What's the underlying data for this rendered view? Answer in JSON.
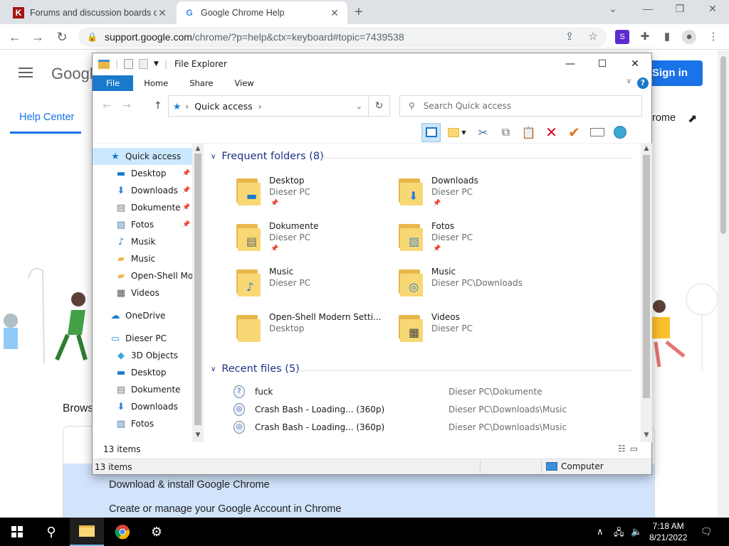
{
  "browser": {
    "tabs": [
      {
        "title": "Forums and discussion boards or",
        "favicon": "K",
        "active": false
      },
      {
        "title": "Google Chrome Help",
        "favicon": "G",
        "active": true
      }
    ],
    "url_host": "support.google.com",
    "url_path": "/chrome/?p=help&ctx=keyboard#topic=7439538"
  },
  "page": {
    "logo": "Googl",
    "sign_in": "Sign in",
    "help_center": "Help Center",
    "chrome_link": "rome",
    "browse": "Brows",
    "links": [
      "Download & install Google Chrome",
      "Create or manage your Google Account in Chrome"
    ]
  },
  "explorer": {
    "title": "File Explorer",
    "ribbon_tabs": [
      "File",
      "Home",
      "Share",
      "View"
    ],
    "address": "Quick access",
    "search_placeholder": "Search Quick access",
    "nav": [
      {
        "label": "Quick access",
        "icon": "star-icon",
        "level": 0,
        "selected": true
      },
      {
        "label": "Desktop",
        "icon": "desktop-icon",
        "level": 1,
        "pinned": true
      },
      {
        "label": "Downloads",
        "icon": "download-icon",
        "level": 1,
        "pinned": true
      },
      {
        "label": "Dokumente",
        "icon": "document-icon",
        "level": 1,
        "pinned": true
      },
      {
        "label": "Fotos",
        "icon": "picture-icon",
        "level": 1,
        "pinned": true
      },
      {
        "label": "Musik",
        "icon": "music-icon",
        "level": 1
      },
      {
        "label": "Music",
        "icon": "folder-icon",
        "level": 1
      },
      {
        "label": "Open-Shell Modern Settings",
        "icon": "folder-icon",
        "level": 1
      },
      {
        "label": "Videos",
        "icon": "video-icon",
        "level": 1
      },
      {
        "label": "OneDrive",
        "icon": "cloud-icon",
        "level": 0
      },
      {
        "label": "Dieser PC",
        "icon": "computer-icon",
        "level": 0
      },
      {
        "label": "3D Objects",
        "icon": "cube-icon",
        "level": 1
      },
      {
        "label": "Desktop",
        "icon": "desktop-icon",
        "level": 1
      },
      {
        "label": "Dokumente",
        "icon": "document-icon",
        "level": 1
      },
      {
        "label": "Downloads",
        "icon": "download-icon",
        "level": 1
      },
      {
        "label": "Fotos",
        "icon": "picture-icon",
        "level": 1
      }
    ],
    "frequent_header": "Frequent folders (8)",
    "frequent": [
      {
        "name": "Desktop",
        "location": "Dieser PC",
        "badge": "desktop",
        "pinned": true
      },
      {
        "name": "Downloads",
        "location": "Dieser PC",
        "badge": "download",
        "pinned": true
      },
      {
        "name": "Dokumente",
        "location": "Dieser PC",
        "badge": "document",
        "pinned": true
      },
      {
        "name": "Fotos",
        "location": "Dieser PC",
        "badge": "picture",
        "pinned": true
      },
      {
        "name": "Music",
        "location": "Dieser PC",
        "badge": "music",
        "pinned": false
      },
      {
        "name": "Music",
        "location": "Dieser PC\\Downloads",
        "badge": "media",
        "pinned": false
      },
      {
        "name": "Open-Shell Modern Setti...",
        "location": "Desktop",
        "badge": "none",
        "pinned": false
      },
      {
        "name": "Videos",
        "location": "Dieser PC",
        "badge": "video",
        "pinned": false
      }
    ],
    "recent_header": "Recent files (5)",
    "recent": [
      {
        "name": "fuck",
        "location": "Dieser PC\\Dokumente"
      },
      {
        "name": "Crash Bash - Loading... (360p)",
        "location": "Dieser PC\\Downloads\\Music"
      },
      {
        "name": "Crash Bash - Loading... (360p)",
        "location": "Dieser PC\\Downloads\\Music"
      }
    ],
    "item_count": "13 items",
    "status_count": "13 items",
    "status_location": "Computer"
  },
  "taskbar": {
    "time": "7:18 AM",
    "date": "8/21/2022"
  },
  "colors": {
    "chrome_accent": "#1a73e8",
    "explorer_file_tab": "#1979ca",
    "group_header": "#1e3287",
    "selection": "#cce8ff"
  }
}
